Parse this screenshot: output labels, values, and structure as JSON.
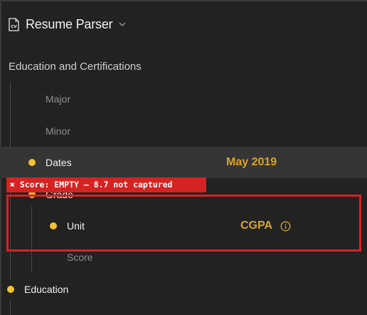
{
  "header": {
    "title": "Resume Parser",
    "icon": "cv-icon"
  },
  "section": {
    "title": "Education and Certifications"
  },
  "fields": [
    {
      "label": "Major",
      "value": "",
      "state": "dim"
    },
    {
      "label": "Minor",
      "value": "",
      "state": "dim"
    },
    {
      "label": "Dates",
      "value": "May 2019",
      "state": "filled",
      "selected": true
    },
    {
      "label": "Grade",
      "value": "",
      "state": "filled"
    },
    {
      "label": "Unit",
      "value": "CGPA",
      "state": "filled",
      "info": true
    },
    {
      "label": "Score",
      "value": "",
      "state": "dim"
    },
    {
      "label": "Education",
      "value": "",
      "state": "filled"
    }
  ],
  "annotation": {
    "message": "✖ Score: EMPTY — 8.7 not captured",
    "color": "#d52323"
  },
  "colors": {
    "background": "#222222",
    "accent_dot": "#f2c230",
    "value_text": "#d9a526",
    "selected_row": "#353535",
    "error": "#d52323"
  }
}
